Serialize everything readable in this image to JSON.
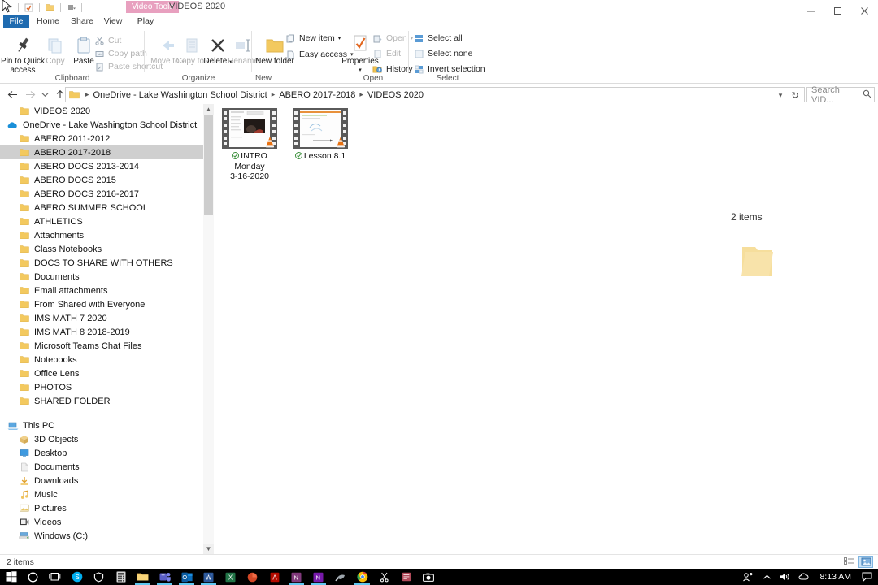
{
  "window": {
    "contextual_tab_label": "Video Tools",
    "title": "VIDEOS 2020",
    "quick_access": [
      "explorer-icon",
      "properties-icon",
      "new-folder-icon",
      "customize-dropdown"
    ],
    "caption": {
      "minimize": "minimize-button",
      "maximize": "maximize-button",
      "close": "close-button"
    },
    "ribbon_collapse": "ribbon-collapse-chevron",
    "help": "?"
  },
  "menu": {
    "tabs": [
      {
        "label": "File",
        "active": false,
        "file": true
      },
      {
        "label": "Home",
        "active": true
      },
      {
        "label": "Share",
        "active": false
      },
      {
        "label": "View",
        "active": false
      },
      {
        "label": "Play",
        "active": false
      }
    ]
  },
  "ribbon": {
    "groups": [
      {
        "name": "Clipboard",
        "label": "Clipboard",
        "big_buttons": [
          {
            "label": "Pin to Quick access",
            "icon": "pin-icon",
            "disabled": false
          },
          {
            "label": "Copy",
            "icon": "copy-icon",
            "disabled": true
          },
          {
            "label": "Paste",
            "icon": "paste-icon",
            "disabled": false
          }
        ],
        "small_buttons": [
          {
            "label": "Cut",
            "icon": "scissors-icon",
            "disabled": true
          },
          {
            "label": "Copy path",
            "icon": "copy-path-icon",
            "disabled": true
          },
          {
            "label": "Paste shortcut",
            "icon": "paste-shortcut-icon",
            "disabled": true
          }
        ]
      },
      {
        "name": "Organize",
        "label": "Organize",
        "big_buttons": [
          {
            "label": "Move to",
            "icon": "move-to-icon",
            "disabled": true,
            "dropdown": true
          },
          {
            "label": "Copy to",
            "icon": "copy-to-icon",
            "disabled": true,
            "dropdown": true
          },
          {
            "label": "Delete",
            "icon": "delete-icon",
            "disabled": false,
            "dropdown": true
          },
          {
            "label": "Rename",
            "icon": "rename-icon",
            "disabled": true
          }
        ],
        "small_buttons": []
      },
      {
        "name": "New",
        "label": "New",
        "big_buttons": [
          {
            "label": "New folder",
            "icon": "new-folder-icon",
            "disabled": false
          }
        ],
        "small_buttons": [
          {
            "label": "New item",
            "icon": "new-item-icon",
            "disabled": false,
            "dropdown": true
          },
          {
            "label": "Easy access",
            "icon": "easy-access-icon",
            "disabled": false,
            "dropdown": true
          }
        ]
      },
      {
        "name": "Open",
        "label": "Open",
        "big_buttons": [
          {
            "label": "Properties",
            "icon": "properties-icon",
            "disabled": false,
            "dropdown": true
          }
        ],
        "small_buttons": [
          {
            "label": "Open",
            "icon": "open-icon",
            "disabled": true,
            "dropdown": true
          },
          {
            "label": "Edit",
            "icon": "edit-icon",
            "disabled": true
          },
          {
            "label": "History",
            "icon": "history-icon",
            "disabled": false
          }
        ]
      },
      {
        "name": "Select",
        "label": "Select",
        "big_buttons": [],
        "small_buttons": [
          {
            "label": "Select all",
            "icon": "select-all-icon",
            "disabled": false
          },
          {
            "label": "Select none",
            "icon": "select-none-icon",
            "disabled": false
          },
          {
            "label": "Invert selection",
            "icon": "invert-selection-icon",
            "disabled": false
          }
        ]
      }
    ]
  },
  "address_bar": {
    "back": "back-arrow-icon",
    "forward": "forward-arrow-icon",
    "recent": "recent-locations-chevron",
    "up": "up-arrow-icon",
    "path_icon": "folder-icon",
    "breadcrumbs": [
      "OneDrive - Lake Washington School District",
      "ABERO 2017-2018",
      "VIDEOS 2020"
    ],
    "dropdown": "path-dropdown-chevron",
    "refresh": "refresh-icon",
    "search_placeholder": "Search VID...",
    "search_value": "",
    "search_icon": "search-icon"
  },
  "nav_pane": {
    "items": [
      {
        "label": "VIDEOS 2020",
        "icon": "folder-icon",
        "level": 2,
        "selected": false
      },
      {
        "label": "OneDrive - Lake Washington School District",
        "icon": "onedrive-cloud-icon",
        "level": 1,
        "selected": false
      },
      {
        "label": "ABERO 2011-2012",
        "icon": "folder-icon",
        "level": 2,
        "selected": false
      },
      {
        "label": "ABERO 2017-2018",
        "icon": "folder-icon",
        "level": 2,
        "selected": true
      },
      {
        "label": "ABERO DOCS 2013-2014",
        "icon": "folder-icon",
        "level": 2,
        "selected": false
      },
      {
        "label": "ABERO DOCS 2015",
        "icon": "folder-icon",
        "level": 2,
        "selected": false
      },
      {
        "label": "ABERO DOCS 2016-2017",
        "icon": "folder-icon",
        "level": 2,
        "selected": false
      },
      {
        "label": "ABERO SUMMER SCHOOL",
        "icon": "folder-icon",
        "level": 2,
        "selected": false
      },
      {
        "label": "ATHLETICS",
        "icon": "folder-icon",
        "level": 2,
        "selected": false
      },
      {
        "label": "Attachments",
        "icon": "folder-icon",
        "level": 2,
        "selected": false
      },
      {
        "label": "Class Notebooks",
        "icon": "folder-icon",
        "level": 2,
        "selected": false
      },
      {
        "label": "DOCS TO SHARE WITH OTHERS",
        "icon": "folder-icon",
        "level": 2,
        "selected": false
      },
      {
        "label": "Documents",
        "icon": "folder-icon",
        "level": 2,
        "selected": false
      },
      {
        "label": "Email attachments",
        "icon": "folder-icon",
        "level": 2,
        "selected": false
      },
      {
        "label": "From Shared with Everyone",
        "icon": "folder-icon",
        "level": 2,
        "selected": false
      },
      {
        "label": "IMS MATH 7 2020",
        "icon": "folder-icon",
        "level": 2,
        "selected": false
      },
      {
        "label": "IMS MATH 8 2018-2019",
        "icon": "folder-icon",
        "level": 2,
        "selected": false
      },
      {
        "label": "Microsoft Teams Chat Files",
        "icon": "folder-icon",
        "level": 2,
        "selected": false
      },
      {
        "label": "Notebooks",
        "icon": "folder-icon",
        "level": 2,
        "selected": false
      },
      {
        "label": "Office Lens",
        "icon": "folder-icon",
        "level": 2,
        "selected": false
      },
      {
        "label": "PHOTOS",
        "icon": "folder-icon",
        "level": 2,
        "selected": false
      },
      {
        "label": "SHARED FOLDER",
        "icon": "folder-icon",
        "level": 2,
        "selected": false
      },
      {
        "label": "",
        "icon": "none",
        "level": 1,
        "selected": false
      },
      {
        "label": "This PC",
        "icon": "this-pc-icon",
        "level": 1,
        "selected": false
      },
      {
        "label": "3D Objects",
        "icon": "3d-objects-icon",
        "level": 2,
        "selected": false
      },
      {
        "label": "Desktop",
        "icon": "desktop-icon",
        "level": 2,
        "selected": false
      },
      {
        "label": "Documents",
        "icon": "documents-icon",
        "level": 2,
        "selected": false
      },
      {
        "label": "Downloads",
        "icon": "downloads-icon",
        "level": 2,
        "selected": false
      },
      {
        "label": "Music",
        "icon": "music-icon",
        "level": 2,
        "selected": false
      },
      {
        "label": "Pictures",
        "icon": "pictures-icon",
        "level": 2,
        "selected": false
      },
      {
        "label": "Videos",
        "icon": "videos-icon",
        "level": 2,
        "selected": false
      },
      {
        "label": "Windows (C:)",
        "icon": "drive-icon",
        "level": 2,
        "selected": false
      }
    ],
    "scroll_up": "scroll-up-arrow",
    "scroll_down": "scroll-down-arrow"
  },
  "files": [
    {
      "name": "INTRO Monday 3-16-2020",
      "name_lines": [
        "INTRO",
        "Monday",
        "3-16-2020"
      ],
      "type": "video",
      "status_icon": "onedrive-synced-check",
      "overlay_icon": "vlc-cone-icon"
    },
    {
      "name": "Lesson 8.1",
      "name_lines": [
        "Lesson 8.1"
      ],
      "type": "video",
      "status_icon": "onedrive-synced-check",
      "overlay_icon": "vlc-cone-icon"
    }
  ],
  "drag": {
    "label": "2 items",
    "ghost_icon": "folder-icon"
  },
  "status_bar": {
    "item_count": "2 items",
    "views": [
      {
        "name": "details-view-button",
        "active": false
      },
      {
        "name": "large-icons-view-button",
        "active": true
      }
    ]
  },
  "taskbar": {
    "items": [
      {
        "name": "start-button",
        "icon": "windows-logo",
        "color": "#ffffff",
        "open": false
      },
      {
        "name": "cortana-button",
        "icon": "circle",
        "color": "#ffffff",
        "open": false
      },
      {
        "name": "task-view-button",
        "icon": "task-view",
        "color": "#ffffff",
        "open": false
      },
      {
        "name": "skype-button",
        "icon": "skype",
        "color": "#00aff0",
        "open": false
      },
      {
        "name": "security-button",
        "icon": "shield",
        "color": "#ffffff",
        "open": false
      },
      {
        "name": "calculator-button",
        "icon": "calculator",
        "color": "#d8d8d8",
        "open": false
      },
      {
        "name": "file-explorer-button",
        "icon": "folder",
        "color": "#f5bf4f",
        "open": true
      },
      {
        "name": "microsoft-teams-button",
        "icon": "teams",
        "color": "#5b5fc7",
        "open": true
      },
      {
        "name": "outlook-button",
        "icon": "outlook",
        "color": "#0a6cba",
        "open": true
      },
      {
        "name": "word-button",
        "icon": "word",
        "color": "#2b579a",
        "open": true
      },
      {
        "name": "excel-button",
        "icon": "excel",
        "color": "#217346",
        "open": false
      },
      {
        "name": "powerpoint-button",
        "icon": "powerpoint",
        "color": "#d24726",
        "open": false
      },
      {
        "name": "acrobat-reader-button",
        "icon": "acrobat",
        "color": "#b30b00",
        "open": false
      },
      {
        "name": "onenote-button",
        "icon": "onenote",
        "color": "#80397b",
        "open": true
      },
      {
        "name": "onenote-2016-button",
        "icon": "onenote2016",
        "color": "#7719aa",
        "open": true
      },
      {
        "name": "paint-3d-button",
        "icon": "paint",
        "color": "#8a8a8a",
        "open": false
      },
      {
        "name": "google-chrome-button",
        "icon": "chrome",
        "color": "#4285f4",
        "open": true
      },
      {
        "name": "snip-sketch-button",
        "icon": "snip",
        "color": "#ffffff",
        "open": false
      },
      {
        "name": "sticky-notes-button",
        "icon": "notes",
        "color": "#b04a5a",
        "open": false
      },
      {
        "name": "camera-button",
        "icon": "camera",
        "color": "#ffffff",
        "open": false
      }
    ],
    "tray": [
      {
        "name": "people-icon",
        "glyph": "people"
      },
      {
        "name": "show-hidden-icons-chevron",
        "glyph": "chevron-up"
      },
      {
        "name": "volume-icon",
        "glyph": "speaker"
      },
      {
        "name": "onedrive-tray-icon",
        "glyph": "cloud"
      }
    ],
    "clock": "8:13 AM",
    "action_center": "action-center-icon"
  }
}
